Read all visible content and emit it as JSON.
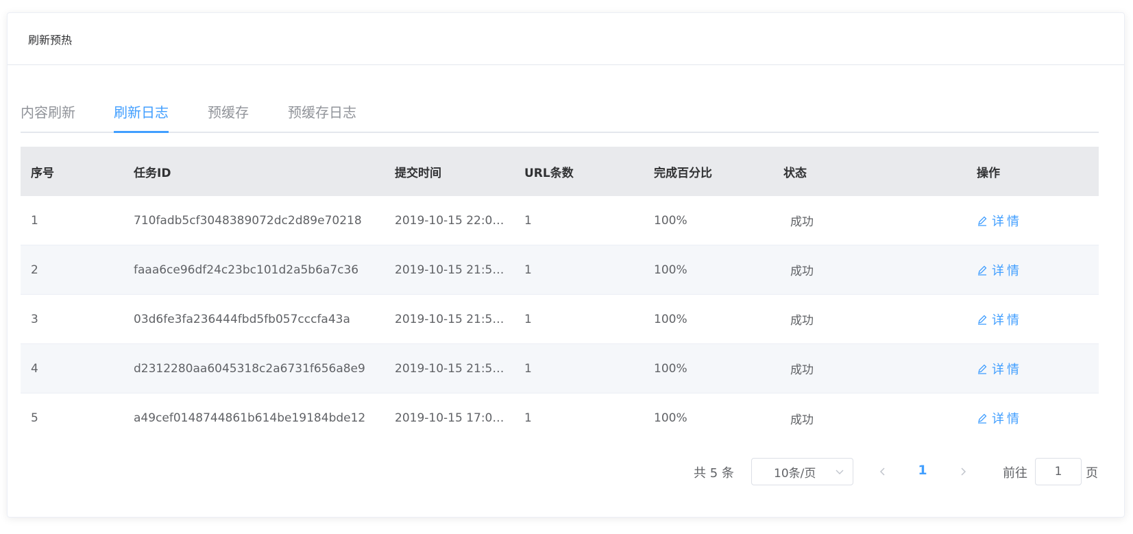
{
  "card": {
    "title": "刷新预热"
  },
  "tabs": [
    {
      "label": "内容刷新",
      "active": false
    },
    {
      "label": "刷新日志",
      "active": true
    },
    {
      "label": "预缓存",
      "active": false
    },
    {
      "label": "预缓存日志",
      "active": false
    }
  ],
  "table": {
    "headers": [
      "序号",
      "任务ID",
      "提交时间",
      "URL条数",
      "完成百分比",
      "状态",
      "操作"
    ],
    "rows": [
      {
        "index": "1",
        "task_id": "710fadb5cf3048389072dc2d89e70218",
        "submit_time": "2019-10-15 22:0…",
        "url_count": "1",
        "percent": "100%",
        "status": "成功",
        "action": "详情"
      },
      {
        "index": "2",
        "task_id": "faaa6ce96df24c23bc101d2a5b6a7c36",
        "submit_time": "2019-10-15 21:5…",
        "url_count": "1",
        "percent": "100%",
        "status": "成功",
        "action": "详情"
      },
      {
        "index": "3",
        "task_id": "03d6fe3fa236444fbd5fb057cccfa43a",
        "submit_time": "2019-10-15 21:5…",
        "url_count": "1",
        "percent": "100%",
        "status": "成功",
        "action": "详情"
      },
      {
        "index": "4",
        "task_id": "d2312280aa6045318c2a6731f656a8e9",
        "submit_time": "2019-10-15 21:5…",
        "url_count": "1",
        "percent": "100%",
        "status": "成功",
        "action": "详情"
      },
      {
        "index": "5",
        "task_id": "a49cef0148744861b614be19184bde12",
        "submit_time": "2019-10-15 17:0…",
        "url_count": "1",
        "percent": "100%",
        "status": "成功",
        "action": "详情"
      }
    ]
  },
  "pagination": {
    "total_text": "共 5 条",
    "page_size": "10条/页",
    "current_page": "1",
    "goto_label": "前往",
    "goto_value": "1",
    "page_label": "页"
  },
  "icons": {
    "edit": "edit-icon",
    "prev": "chevron-left-icon",
    "next": "chevron-right-icon",
    "dropdown": "chevron-down-icon"
  },
  "colors": {
    "accent": "#409eff",
    "header_bg": "#e9eaed",
    "stripe_bg": "#f5f7fa"
  }
}
